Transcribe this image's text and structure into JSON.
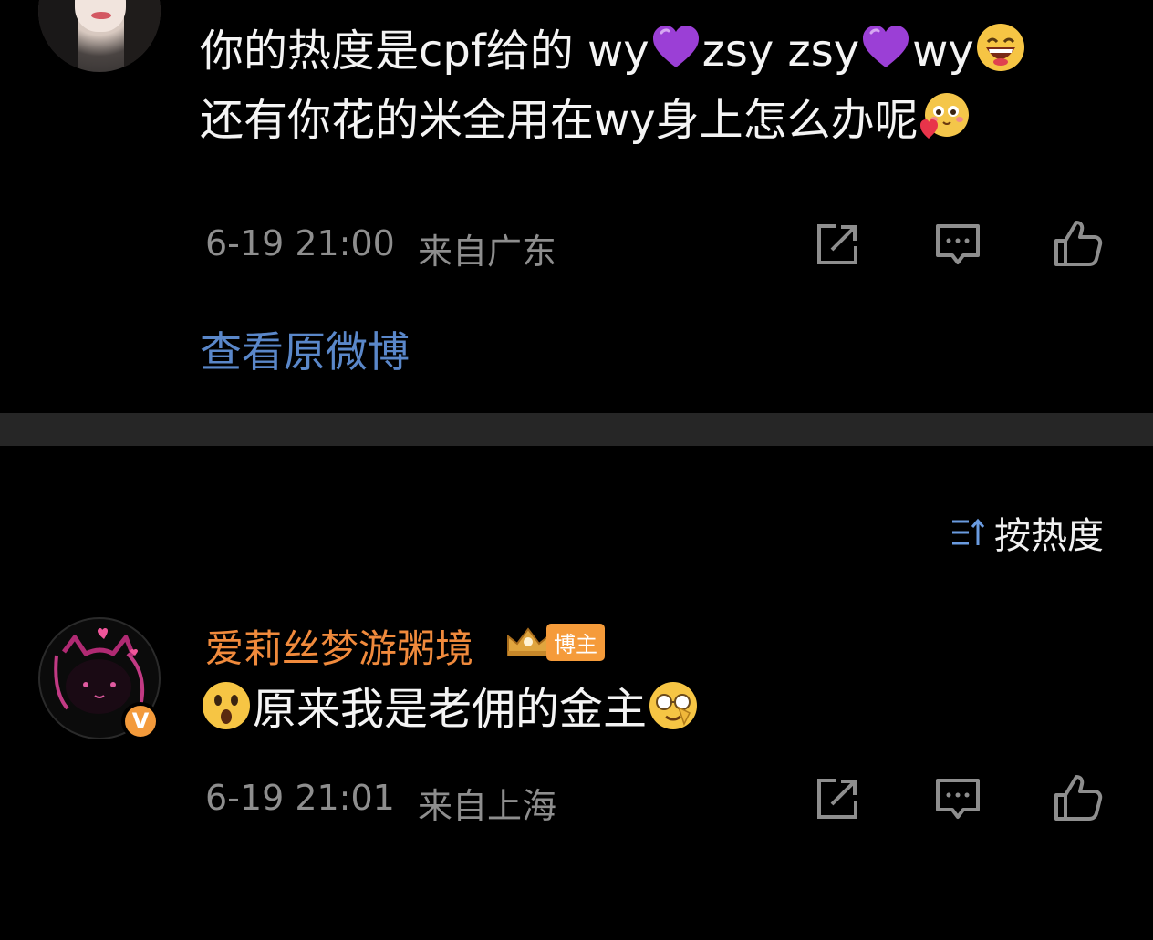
{
  "comment_1": {
    "text_line1_a": "你的热度是cpf给的  wy",
    "text_line1_b": "zsy zsy",
    "text_line1_c": "wy",
    "text_line2": "还有你花的米全用在wy身上怎么办呢",
    "timestamp": "6-19 21:00",
    "location": "来自广东",
    "view_original_label": "查看原微博"
  },
  "sort": {
    "label": "按热度"
  },
  "comment_2": {
    "username": "爱莉丝梦游粥境",
    "badge_label": "博主",
    "verified_label": "V",
    "text": "原来我是老佣的金主",
    "timestamp": "6-19 21:01",
    "location": "来自上海"
  },
  "colors": {
    "background": "#000000",
    "divider": "#262626",
    "link": "#5a87c9",
    "username": "#f08a3c",
    "meta": "#8e8e8e",
    "badge": "#f59b3a"
  },
  "icons": [
    "share-icon",
    "comment-icon",
    "like-icon",
    "sort-icon",
    "purple-heart-icon",
    "grinning-face-icon",
    "hearts-face-icon",
    "surprised-face-icon",
    "smirk-face-icon",
    "crown-icon"
  ]
}
